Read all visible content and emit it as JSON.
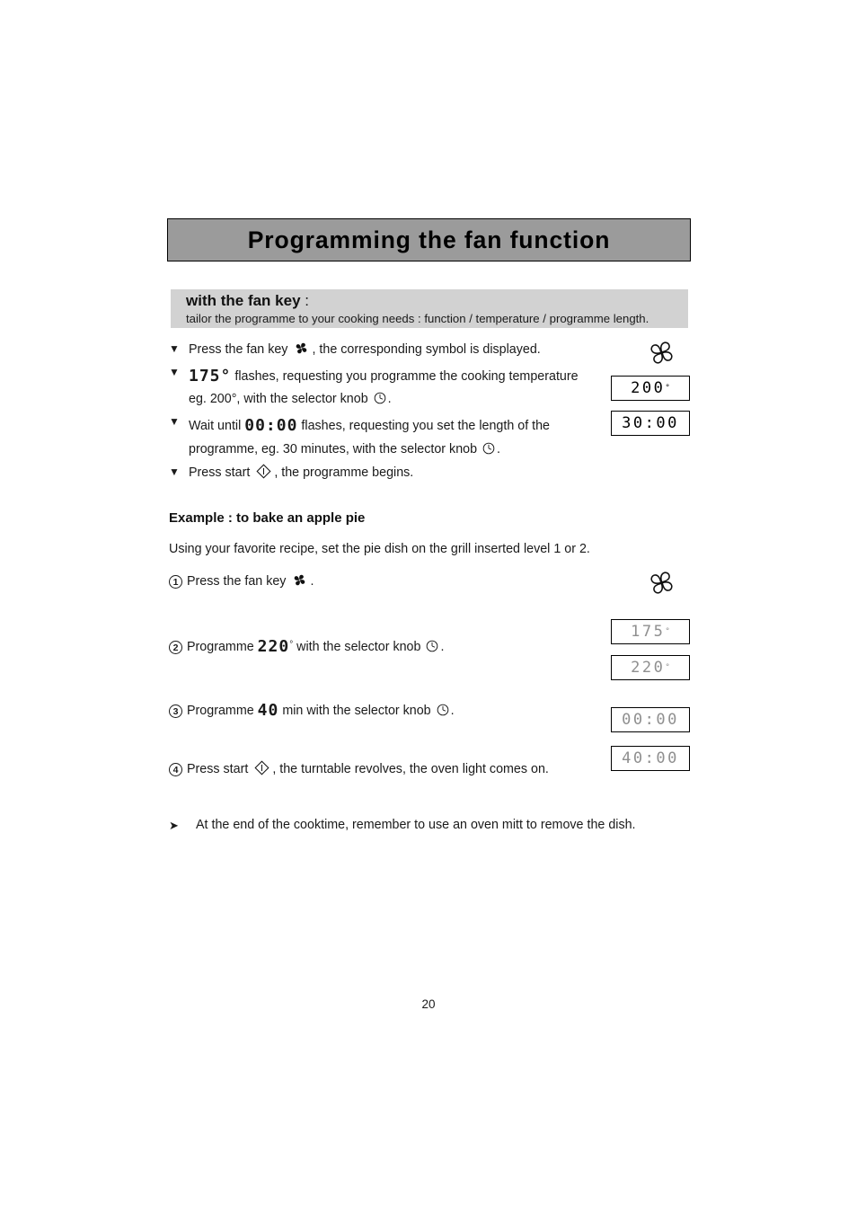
{
  "page": {
    "title": "Programming the fan function",
    "number": "20"
  },
  "subheader": {
    "title": "with the fan key",
    "colon": " :",
    "description": "tailor the programme to your cooking needs : function / temperature / programme length."
  },
  "instructions": {
    "bullet_glyph": "▼",
    "items": [
      {
        "pre": "Press the fan key",
        "icon": "fan-icon",
        "post": ", the corresponding symbol is displayed."
      },
      {
        "lcd": "175°",
        "pre": "",
        "mid": "flashes, requesting you programme the cooking temperature eg. 200°, with the selector knob",
        "icon": "selector-knob-icon",
        "post": "."
      },
      {
        "pre": "Wait until",
        "lcd": "00:00",
        "mid": "flashes, requesting you set the length of the programme, eg. 30 minutes, with the selector knob",
        "icon": "selector-knob-icon",
        "post": "."
      },
      {
        "pre": "Press start",
        "icon": "start-icon",
        "post": ", the programme begins."
      }
    ]
  },
  "example": {
    "heading": "Example : to bake an apple pie",
    "intro": "Using your favorite recipe, set the pie dish on the grill inserted level 1 or 2.",
    "steps": [
      {
        "num": "1",
        "pre": "Press the fan key",
        "icon": "fan-icon",
        "post": "."
      },
      {
        "num": "2",
        "pre": "Programme",
        "lcd": "220",
        "deg": "°",
        "mid": "with the selector knob",
        "icon": "selector-knob-icon",
        "post": "."
      },
      {
        "num": "3",
        "pre": "Programme",
        "lcd": "40",
        "mid": "min with the selector knob",
        "icon": "selector-knob-icon",
        "post": "."
      },
      {
        "num": "4",
        "pre": "Press start",
        "icon": "start-icon",
        "post": ", the turntable revolves, the oven light comes on."
      }
    ]
  },
  "displays": {
    "top": [
      {
        "name": "temperature-200",
        "value": "200",
        "degree": "°",
        "style": "black"
      },
      {
        "name": "time-30-00",
        "value": "30:00",
        "degree": "",
        "style": "black"
      }
    ],
    "example": [
      {
        "name": "temperature-175",
        "value": "175",
        "degree": "°",
        "style": "grey"
      },
      {
        "name": "temperature-220",
        "value": "220",
        "degree": "°",
        "style": "grey"
      },
      {
        "name": "time-00-00",
        "value": "00:00",
        "degree": "",
        "style": "grey"
      },
      {
        "name": "time-40-00",
        "value": "40:00",
        "degree": "",
        "style": "grey"
      }
    ]
  },
  "footnote": {
    "glyph": "➤",
    "text": "At the end of the cooktime, remember to use an oven mitt to remove the dish."
  },
  "colors": {
    "banner_grey": "#9b9b9b",
    "subband_grey": "#d2d2d2",
    "lcd_black": "#000000",
    "lcd_grey": "#8f8f8f"
  }
}
